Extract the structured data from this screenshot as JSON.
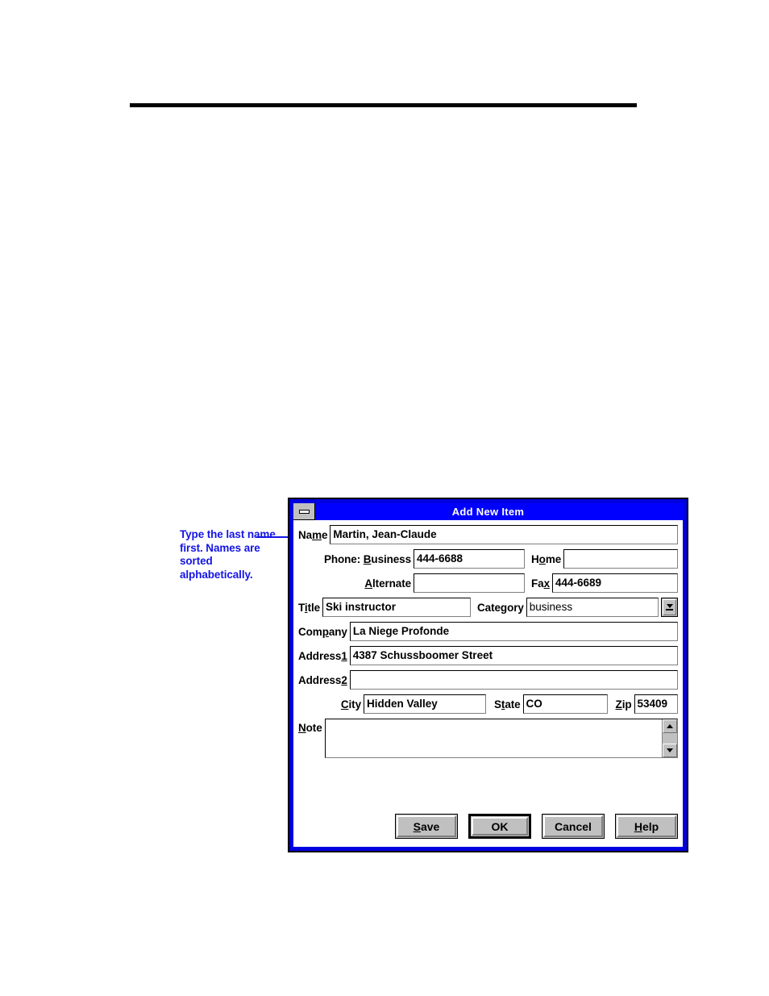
{
  "page": {
    "rule": "horizontal-rule"
  },
  "annotation": {
    "text": "Type the last name first. Names are sorted alphabetically.",
    "color": "#1414e6"
  },
  "dialog": {
    "title": "Add New Item",
    "titlebar_color": "#0000ff",
    "frame_color": "#0000e0",
    "minimize_button": "minimize-box",
    "fields": {
      "name": {
        "label_pre": "Na",
        "label_key": "m",
        "label_post": "e",
        "value": "Martin, Jean-Claude"
      },
      "phone_business": {
        "label_pre": "Phone: ",
        "label_key": "B",
        "label_post": "usiness",
        "value": "444-6688"
      },
      "home": {
        "label_pre": "H",
        "label_key": "o",
        "label_post": "me",
        "value": ""
      },
      "alternate": {
        "label_pre": "",
        "label_key": "A",
        "label_post": "lternate",
        "value": ""
      },
      "fax": {
        "label_pre": "Fa",
        "label_key": "x",
        "label_post": "",
        "value": "444-6689"
      },
      "title": {
        "label_pre": "T",
        "label_key": "i",
        "label_post": "tle",
        "value": "Ski instructor"
      },
      "category": {
        "label_pre": "Cate",
        "label_key": "g",
        "label_post": "ory",
        "value": "business"
      },
      "company": {
        "label_pre": "Com",
        "label_key": "p",
        "label_post": "any",
        "value": "La Niege Profonde"
      },
      "address1": {
        "label_pre": "Address",
        "label_key": "1",
        "label_post": "",
        "value": "4387 Schussboomer Street"
      },
      "address2": {
        "label_pre": "Address",
        "label_key": "2",
        "label_post": "",
        "value": ""
      },
      "city": {
        "label_pre": "",
        "label_key": "C",
        "label_post": "ity",
        "value": "Hidden Valley"
      },
      "state": {
        "label_pre": "S",
        "label_key": "t",
        "label_post": "ate",
        "value": "CO"
      },
      "zip": {
        "label_pre": "",
        "label_key": "Z",
        "label_post": "ip",
        "value": "53409"
      },
      "note": {
        "label_pre": "",
        "label_key": "N",
        "label_post": "ote",
        "value": ""
      }
    },
    "buttons": [
      {
        "pre": "",
        "key": "S",
        "post": "ave",
        "label": "Save",
        "default": false
      },
      {
        "pre": "OK",
        "key": "",
        "post": "",
        "label": "OK",
        "default": true
      },
      {
        "pre": "Cancel",
        "key": "",
        "post": "",
        "label": "Cancel",
        "default": false
      },
      {
        "pre": "",
        "key": "H",
        "post": "elp",
        "label": "Help",
        "default": false
      }
    ]
  }
}
